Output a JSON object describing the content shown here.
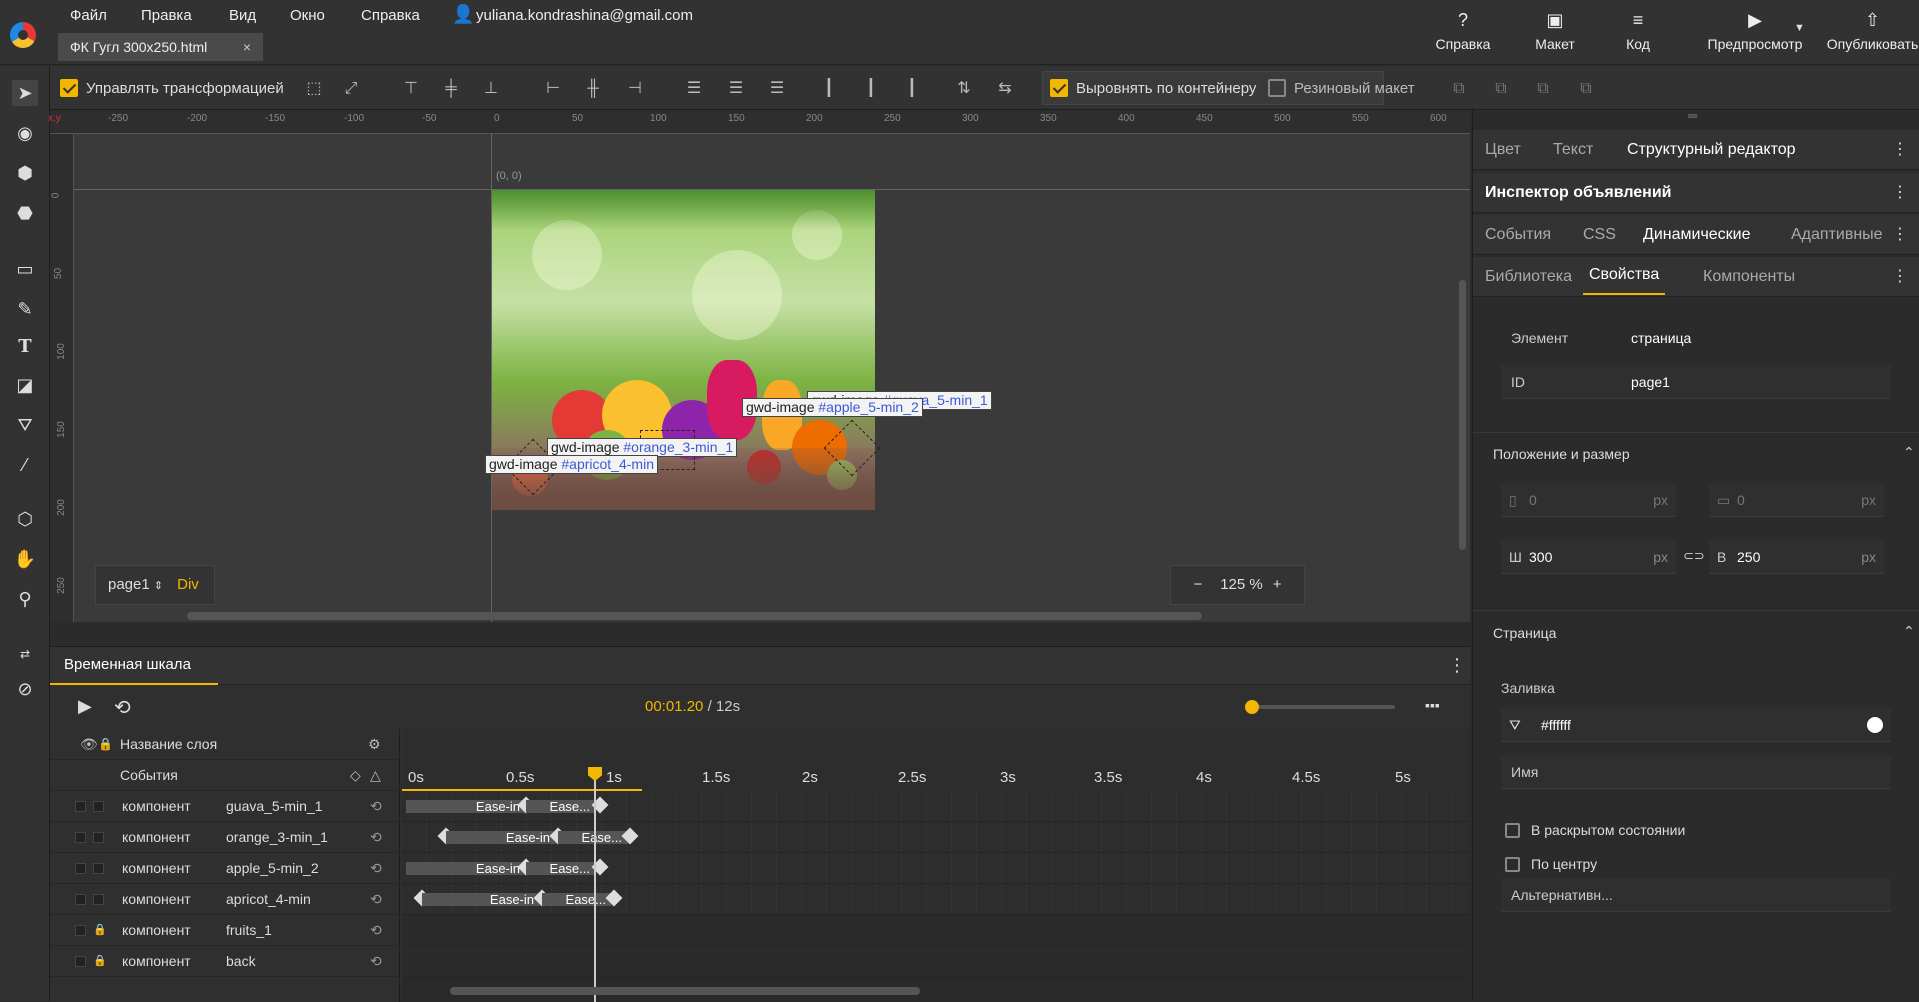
{
  "app": {
    "menus": [
      "Файл",
      "Правка",
      "Вид",
      "Окно",
      "Справка"
    ],
    "user": "yuliana.kondrashina@gmail.com",
    "doc_tab": "ФК Гугл 300x250.html",
    "doc_close": "×"
  },
  "top_buttons": {
    "help": "Справка",
    "layout": "Макет",
    "code": "Код",
    "preview": "Предпросмотр",
    "publish": "Опубликовать"
  },
  "toolbar": {
    "manage_transform": "Управлять трансформацией",
    "align_container": "Выровнять по контейнеру",
    "rubber_layout": "Резиновый макет",
    "manage_checked": true,
    "align_checked": true,
    "rubber_checked": false
  },
  "rulers": {
    "h": [
      "-250",
      "-200",
      "-150",
      "-100",
      "-50",
      "0",
      "50",
      "100",
      "150",
      "200",
      "250",
      "300",
      "350",
      "400",
      "450",
      "500",
      "550",
      "600"
    ],
    "v": [
      "0",
      "50",
      "100",
      "150",
      "200",
      "250"
    ],
    "xy": "x,y"
  },
  "canvas": {
    "origin": "(0, 0)",
    "page": "page1",
    "page_type": "Div",
    "zoom_minus": "−",
    "zoom": "125 %",
    "zoom_plus": "+"
  },
  "labels": [
    {
      "prefix": "gwd-image",
      "id": "#guava_5-min_1"
    },
    {
      "prefix": "gwd-image",
      "id": "#apple_5-min_2"
    },
    {
      "prefix": "gwd-image",
      "id": "#orange_3-min_1"
    },
    {
      "prefix": "gwd-image",
      "id": "#apricot_4-min"
    }
  ],
  "timeline": {
    "tab": "Временная шкала",
    "current": "00:01.20",
    "total": "/ 12s",
    "layer_header": "Название слоя",
    "events": "События",
    "ticks": [
      "0s",
      "0.5s",
      "1s",
      "1.5s",
      "2s",
      "2.5s",
      "3s",
      "3.5s",
      "4s",
      "4.5s",
      "5s"
    ],
    "layers": [
      {
        "kind": "компонент",
        "name": "guava_5-min_1",
        "seg1": "Ease-in",
        "seg2": "Ease..."
      },
      {
        "kind": "компонент",
        "name": "orange_3-min_1",
        "seg1": "Ease-in",
        "seg2": "Ease..."
      },
      {
        "kind": "компонент",
        "name": "apple_5-min_2",
        "seg1": "Ease-in",
        "seg2": "Ease..."
      },
      {
        "kind": "компонент",
        "name": "apricot_4-min",
        "seg1": "Ease-in",
        "seg2": "Ease..."
      },
      {
        "kind": "компонент",
        "name": "fruits_1"
      },
      {
        "kind": "компонент",
        "name": "back"
      }
    ]
  },
  "right_panel": {
    "tabs1": [
      "Цвет",
      "Текст",
      "Структурный редактор"
    ],
    "inspector": "Инспектор объявлений",
    "tabs2": [
      "События",
      "CSS",
      "Динамические",
      "Адаптивные"
    ],
    "tabs3": [
      "Библиотека",
      "Свойства",
      "Компоненты"
    ],
    "element_label": "Элемент",
    "element_value": "страница",
    "id_label": "ID",
    "id_value": "page1",
    "pos_size": "Положение и размер",
    "x": "0",
    "y": "0",
    "unit": "px",
    "w_label": "Ш",
    "w": "300",
    "h_label": "В",
    "h": "250",
    "page_section": "Страница",
    "fill_label": "Заливка",
    "fill": "#ffffff",
    "name_label": "Имя",
    "expanded": "В раскрытом состоянии",
    "centered": "По центру",
    "alt": "Альтернативн..."
  }
}
